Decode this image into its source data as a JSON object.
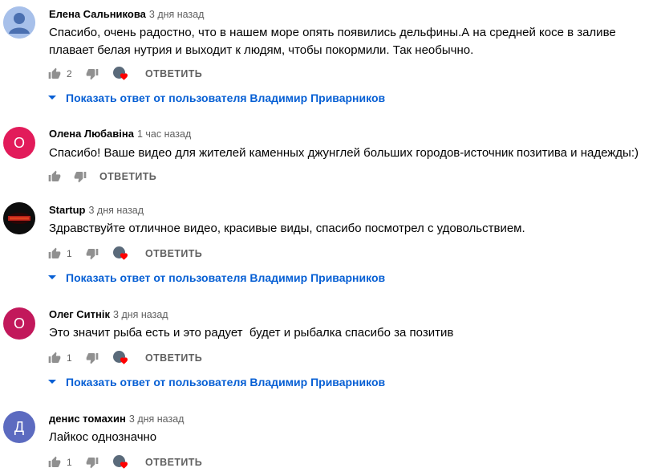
{
  "colors": {
    "link": "#065fd4",
    "meta": "#606060",
    "heart": "#ff0000"
  },
  "actions": {
    "reply_label": "ОТВЕТИТЬ"
  },
  "comments": [
    {
      "author": "Елена Сальникова",
      "time": "3 дня назад",
      "avatar_letter": "",
      "avatar_color": "#9bb7e6",
      "text": "Спасибо, очень радостно, что в нашем море опять появились дельфины.А на средней косе в заливе плавает белая нутрия и выходит к людям, чтобы покормили. Так необычно.",
      "likes": "2",
      "replies_label": "Показать ответ от пользователя Владимир Приварников"
    },
    {
      "author": "Олена Любавіна",
      "time": "1 час назад",
      "avatar_letter": "О",
      "avatar_color": "#e21b5a",
      "text": "Спасибо! Ваше видео для жителей каменных джунглей больших городов-источник позитива и надежды:)",
      "likes": "",
      "replies_label": ""
    },
    {
      "author": "Startup",
      "time": "3 дня назад",
      "avatar_letter": "",
      "avatar_color": "#0d0d0d",
      "text": "Здравствуйте отличное видео, красивые виды, спасибо посмотрел с удовольствием.",
      "likes": "1",
      "replies_label": "Показать ответ от пользователя Владимир Приварников"
    },
    {
      "author": "Олег Ситнік",
      "time": "3 дня назад",
      "avatar_letter": "О",
      "avatar_color": "#c2185b",
      "text": "Это значит рыба есть и это радует  будет и рыбалка спасибо за позитив",
      "likes": "1",
      "replies_label": "Показать ответ от пользователя Владимир Приварников"
    },
    {
      "author": "денис томахин",
      "time": "3 дня назад",
      "avatar_letter": "Д",
      "avatar_color": "#5c6bc0",
      "text": "Лайкос однозначно",
      "likes": "1",
      "replies_label": ""
    }
  ]
}
